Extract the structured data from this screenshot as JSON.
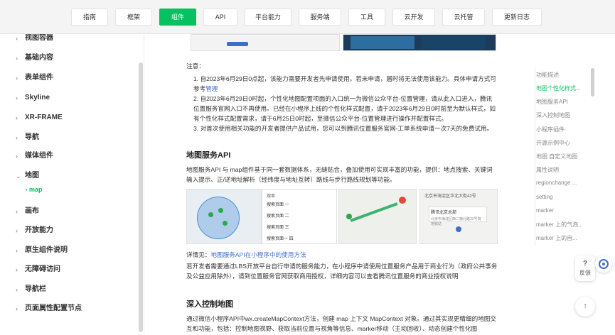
{
  "nav": {
    "items": [
      "指南",
      "框架",
      "组件",
      "API",
      "平台能力",
      "服务端",
      "工具",
      "云开发",
      "云托管",
      "更新日志"
    ],
    "active_index": 2
  },
  "sidebar": {
    "items": [
      "视图容器",
      "基础内容",
      "表单组件",
      "Skyline",
      "XR-FRAME",
      "导航",
      "媒体组件",
      "地图",
      "画布",
      "开放能力",
      "原生组件说明",
      "无障碍访问",
      "导航栏",
      "页面属性配置节点"
    ],
    "expanded_index": 7,
    "sub_item": "map"
  },
  "content": {
    "note_label": "注意：",
    "note_1": "自2023年6月29日0点起，该能力需要开发者先申请使用。若未申请，届时将无法使用该能力。具体申请方式可参考",
    "note_1_link": "管理",
    "note_2": "自2023年6月29日0时起，个性化地图配置项面的入口统一为微信公众平台-位置管理，请从此入口进入，腾讯位置服务官网入口不再使用。已经在小程序上线的个性化样式配置，请于2023年6月29日0时前至为默认样式，如有个性化样式配置需求，请于6月25日0时起，至微信公众平台-位置管理进行操作并配置样式。",
    "note_3": "对首次使用相关功能的开发者提供产品试用，您可以到腾讯位置服务官网-工单系统申请一次7天的免费试用。",
    "section1_title": "地图服务API",
    "section1_desc": "地图服务API 与 map组件基于同一套数据体系，无缝贴合，叠加使用可实现丰富的功能，提供：地点搜索、关键词输入提示、正/逆地址解析（经纬度与地址互转）路线与步行路线规划等功能。",
    "see_more_prefix": "详情见：",
    "see_more_link": "地图服务API在小程序中的使用方法",
    "section1_extra": "若开发者需要通过LBS开放平台自行申请的服务能力，在小程序中请使用位置服务产品用于商业行为（政府公共事务及公益应用除外），请到位置服务官网获取商用授权，详细内容可以查看腾讯位置服务的商业授权说明",
    "section2_title": "深入控制地图",
    "section2_desc": "通过微信小程序API中wx.createMapContext方法，创建 map 上下文 MapContext 对象。通过其实现更精细的地图交互和功能，包括：控制地图视野、获取当前位置与视角等信息、marker移动（主动回收）、动态创建个性化图",
    "demo_search": "搜索",
    "demo_list": [
      "搜索页面 一",
      "搜索页面 二",
      "搜索页面 三",
      "搜索页面一 四"
    ],
    "demo_address": "北京市海淀区华北大街42号",
    "demo_info_title": "腾讯北京总部",
    "demo_info_desc": "北京市海淀区西二旗北路33号院 地铁站"
  },
  "toc": {
    "items": [
      "功能描述",
      "地图个性化样式...",
      "地图服务API",
      "深入控制地图",
      "小程序插件",
      "开源示例中心",
      "地图 自定义地图",
      "属性说明",
      "regionchange ...",
      "setting",
      "marker",
      "marker 上的气泡...",
      "marker 上的自..."
    ],
    "active_index": 1
  },
  "float": {
    "feedback": "反馈",
    "help": "?",
    "top": "↑"
  }
}
